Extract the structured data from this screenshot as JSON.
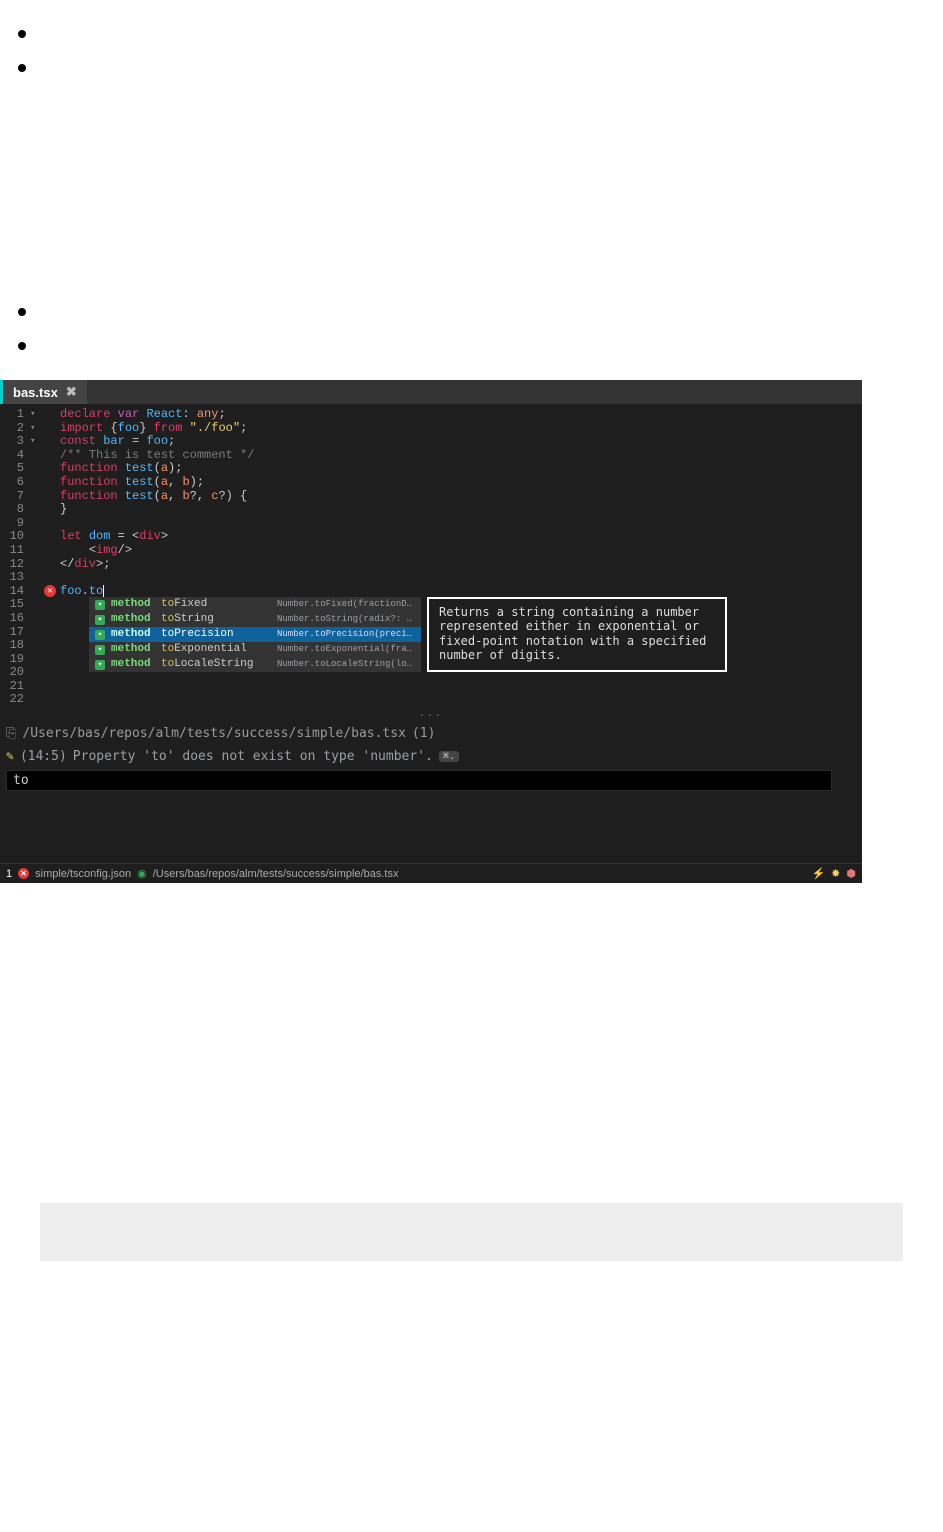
{
  "tab": {
    "label": "bas.tsx",
    "close": "✖"
  },
  "code": {
    "lines": [
      {
        "n": 1,
        "fold": "",
        "err": "",
        "html": "<span class='kw'>declare</span> <span class='kw2'>var</span> <span class='id'>React</span><span class='punct'>:</span> <span class='type'>any</span><span class='punct'>;</span>"
      },
      {
        "n": 2,
        "fold": "▾",
        "err": "",
        "html": "<span class='kw'>import</span> <span class='punct'>{</span><span class='id'>foo</span><span class='punct'>}</span> <span class='kw'>from</span> <span class='str'>\"./foo\"</span><span class='punct'>;</span>"
      },
      {
        "n": 3,
        "fold": "",
        "err": "",
        "html": "<span class='kw'>const</span> <span class='id'>bar</span> <span class='punct'>=</span> <span class='id'>foo</span><span class='punct'>;</span>"
      },
      {
        "n": 4,
        "fold": "",
        "err": "",
        "html": "<span class='comment'>/** This is test comment */</span>"
      },
      {
        "n": 5,
        "fold": "",
        "err": "",
        "html": "<span class='kw'>function</span> <span class='fn'>test</span><span class='punct'>(</span><span class='arg'>a</span><span class='punct'>);</span>"
      },
      {
        "n": 6,
        "fold": "",
        "err": "",
        "html": "<span class='kw'>function</span> <span class='fn'>test</span><span class='punct'>(</span><span class='arg'>a</span><span class='punct'>,</span> <span class='arg'>b</span><span class='punct'>);</span>"
      },
      {
        "n": 7,
        "fold": "▾",
        "err": "",
        "html": "<span class='kw'>function</span> <span class='fn'>test</span><span class='punct'>(</span><span class='arg'>a</span><span class='punct'>,</span> <span class='arg'>b</span><span class='punct'>?,</span> <span class='arg'>c</span><span class='punct'>?) {</span>"
      },
      {
        "n": 8,
        "fold": "",
        "err": "",
        "html": "<span class='punct'>}</span>"
      },
      {
        "n": 9,
        "fold": "",
        "err": "",
        "html": ""
      },
      {
        "n": 10,
        "fold": "▾",
        "err": "",
        "html": "<span class='kw'>let</span> <span class='id'>dom</span> <span class='punct'>=</span> <span class='punct'>&lt;</span><span class='tag'>div</span><span class='punct'>&gt;</span>"
      },
      {
        "n": 11,
        "fold": "",
        "err": "",
        "html": "    <span class='punct'>&lt;</span><span class='tag'>img</span><span class='punct'>/&gt;</span>"
      },
      {
        "n": 12,
        "fold": "",
        "err": "",
        "html": "<span class='punct'>&lt;/</span><span class='tag'>div</span><span class='punct'>&gt;;</span>"
      },
      {
        "n": 13,
        "fold": "",
        "err": "",
        "html": ""
      },
      {
        "n": 14,
        "fold": "",
        "err": "x",
        "html": "<span class='id'>foo</span><span class='punct'>.</span><span class='id'>to</span><span class='cursor'></span>"
      },
      {
        "n": 15,
        "fold": "",
        "err": "",
        "html": ""
      },
      {
        "n": 16,
        "fold": "",
        "err": "",
        "html": ""
      },
      {
        "n": 17,
        "fold": "",
        "err": "",
        "html": ""
      },
      {
        "n": 18,
        "fold": "",
        "err": "",
        "html": ""
      },
      {
        "n": 19,
        "fold": "",
        "err": "",
        "html": ""
      },
      {
        "n": 20,
        "fold": "",
        "err": "",
        "html": ""
      },
      {
        "n": 21,
        "fold": "",
        "err": "",
        "html": ""
      },
      {
        "n": 22,
        "fold": "",
        "err": "",
        "html": ""
      }
    ]
  },
  "intellisense": {
    "items": [
      {
        "kind": "method",
        "name_pre": "to",
        "name_rest": "Fixed",
        "sig": "Number.toFixed(fractionDigits?: number):…",
        "selected": false
      },
      {
        "kind": "method",
        "name_pre": "to",
        "name_rest": "String",
        "sig": "Number.toString(radix?: number): string",
        "selected": false
      },
      {
        "kind": "method",
        "name_pre": "to",
        "name_rest": "Precision",
        "sig": "Number.toPrecision(precision?: number): …",
        "selected": true
      },
      {
        "kind": "method",
        "name_pre": "to",
        "name_rest": "Exponential",
        "sig": "Number.toExponential(fractionDigits?: nu…",
        "selected": false
      },
      {
        "kind": "method",
        "name_pre": "to",
        "name_rest": "LocaleString",
        "sig": "Number.toLocaleString(locales?: string[]…",
        "selected": false
      }
    ],
    "doc": "Returns a string containing a number represented either in exponential or fixed-point notation with a specified number of digits."
  },
  "problems": {
    "path": "/Users/bas/repos/alm/tests/success/simple/bas.tsx",
    "count": "(1)",
    "loc": "(14:5)",
    "msg": "Property 'to' does not exist on type 'number'.",
    "kbd": "⌘.",
    "filter_value": "to"
  },
  "status": {
    "errors": "1",
    "config": "simple/tsconfig.json",
    "filepath": "/Users/bas/repos/alm/tests/success/simple/bas.tsx"
  }
}
